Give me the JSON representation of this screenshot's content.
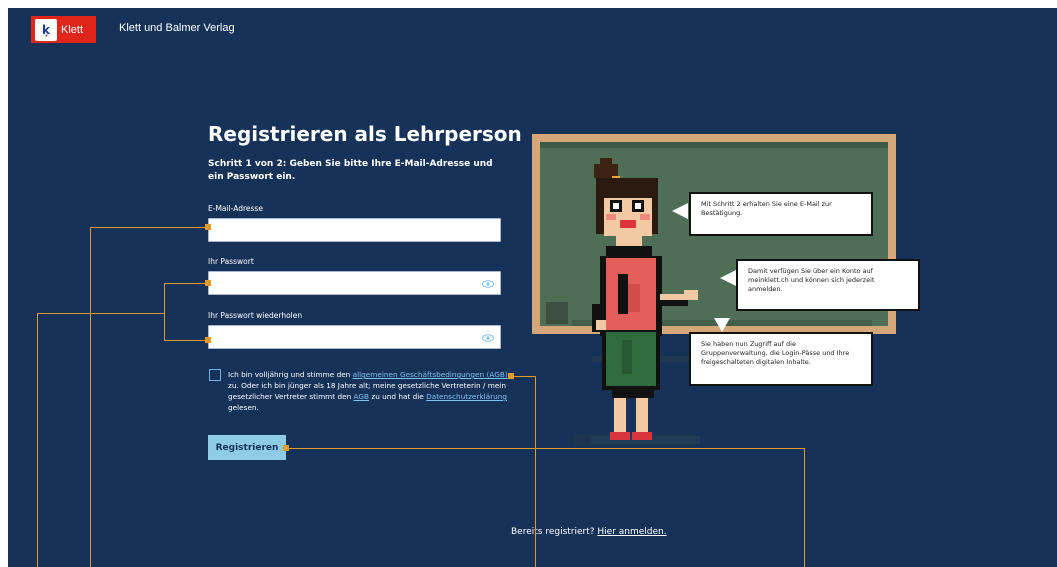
{
  "header": {
    "logo_text": "Klett",
    "logo_mark": "ķ",
    "publisher": "Klett und Balmer Verlag"
  },
  "form": {
    "title": "Registrieren als Lehrperson",
    "subtitle": "Schritt 1 von 2: Geben Sie bitte Ihre E-Mail-Adresse und ein Passwort ein.",
    "email_label": "E-Mail-Adresse",
    "email_value": "",
    "password_label": "Ihr Passwort",
    "password_value": "",
    "password_repeat_label": "Ihr Passwort wiederholen",
    "password_repeat_value": "",
    "terms_part1": "Ich bin volljährig und stimme den ",
    "terms_link_agb_full": "allgemeinen Geschäftsbedingungen (AGB)",
    "terms_part2": " zu. Oder ich bin jünger als 18 Jahre alt; meine gesetzliche Vertreterin / mein gesetzlicher Vertreter stimmt den ",
    "terms_link_agb": "AGB",
    "terms_part3": " zu und hat die ",
    "terms_link_privacy": "Datenschutzerklärung",
    "terms_part4": " gelesen.",
    "terms_checked": false,
    "register_label": "Registrieren"
  },
  "login": {
    "prompt": "Bereits registriert? ",
    "link": "Hier anmelden."
  },
  "illustration": {
    "bubble1": "Mit Schritt 2 erhalten Sie eine E-Mail zur Bestätigung.",
    "bubble2": "Damit verfügen Sie über ein Konto auf meinklett.ch und können sich jederzeit anmelden.",
    "bubble3": "Sie haben nun Zugriff auf die Gruppenverwaltung, die Login-Pässe und Ihre freigeschalteten digitalen Inhalte."
  },
  "colors": {
    "background": "#173259",
    "accent": "#8ecbe9",
    "annotation": "#e39a26",
    "brand": "#e2251b"
  },
  "icons": [
    "klett-logo-icon",
    "eye-icon"
  ]
}
